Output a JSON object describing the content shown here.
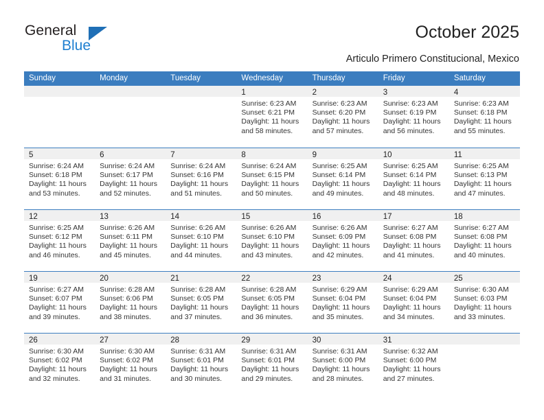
{
  "brand": {
    "name_top": "General",
    "name_bottom": "Blue",
    "accent_color": "#1f7fd0",
    "triangle_color": "#1f6fb6"
  },
  "header": {
    "title": "October 2025",
    "subtitle": "Articulo Primero Constitucional, Mexico"
  },
  "calendar": {
    "header_bg": "#3b7dbf",
    "day_strip_bg": "#f0f0f0",
    "weekdays": [
      "Sunday",
      "Monday",
      "Tuesday",
      "Wednesday",
      "Thursday",
      "Friday",
      "Saturday"
    ],
    "weeks": [
      [
        {
          "day": "",
          "lines": []
        },
        {
          "day": "",
          "lines": []
        },
        {
          "day": "",
          "lines": []
        },
        {
          "day": "1",
          "lines": [
            "Sunrise: 6:23 AM",
            "Sunset: 6:21 PM",
            "Daylight: 11 hours",
            "and 58 minutes."
          ]
        },
        {
          "day": "2",
          "lines": [
            "Sunrise: 6:23 AM",
            "Sunset: 6:20 PM",
            "Daylight: 11 hours",
            "and 57 minutes."
          ]
        },
        {
          "day": "3",
          "lines": [
            "Sunrise: 6:23 AM",
            "Sunset: 6:19 PM",
            "Daylight: 11 hours",
            "and 56 minutes."
          ]
        },
        {
          "day": "4",
          "lines": [
            "Sunrise: 6:23 AM",
            "Sunset: 6:18 PM",
            "Daylight: 11 hours",
            "and 55 minutes."
          ]
        }
      ],
      [
        {
          "day": "5",
          "lines": [
            "Sunrise: 6:24 AM",
            "Sunset: 6:18 PM",
            "Daylight: 11 hours",
            "and 53 minutes."
          ]
        },
        {
          "day": "6",
          "lines": [
            "Sunrise: 6:24 AM",
            "Sunset: 6:17 PM",
            "Daylight: 11 hours",
            "and 52 minutes."
          ]
        },
        {
          "day": "7",
          "lines": [
            "Sunrise: 6:24 AM",
            "Sunset: 6:16 PM",
            "Daylight: 11 hours",
            "and 51 minutes."
          ]
        },
        {
          "day": "8",
          "lines": [
            "Sunrise: 6:24 AM",
            "Sunset: 6:15 PM",
            "Daylight: 11 hours",
            "and 50 minutes."
          ]
        },
        {
          "day": "9",
          "lines": [
            "Sunrise: 6:25 AM",
            "Sunset: 6:14 PM",
            "Daylight: 11 hours",
            "and 49 minutes."
          ]
        },
        {
          "day": "10",
          "lines": [
            "Sunrise: 6:25 AM",
            "Sunset: 6:14 PM",
            "Daylight: 11 hours",
            "and 48 minutes."
          ]
        },
        {
          "day": "11",
          "lines": [
            "Sunrise: 6:25 AM",
            "Sunset: 6:13 PM",
            "Daylight: 11 hours",
            "and 47 minutes."
          ]
        }
      ],
      [
        {
          "day": "12",
          "lines": [
            "Sunrise: 6:25 AM",
            "Sunset: 6:12 PM",
            "Daylight: 11 hours",
            "and 46 minutes."
          ]
        },
        {
          "day": "13",
          "lines": [
            "Sunrise: 6:26 AM",
            "Sunset: 6:11 PM",
            "Daylight: 11 hours",
            "and 45 minutes."
          ]
        },
        {
          "day": "14",
          "lines": [
            "Sunrise: 6:26 AM",
            "Sunset: 6:10 PM",
            "Daylight: 11 hours",
            "and 44 minutes."
          ]
        },
        {
          "day": "15",
          "lines": [
            "Sunrise: 6:26 AM",
            "Sunset: 6:10 PM",
            "Daylight: 11 hours",
            "and 43 minutes."
          ]
        },
        {
          "day": "16",
          "lines": [
            "Sunrise: 6:26 AM",
            "Sunset: 6:09 PM",
            "Daylight: 11 hours",
            "and 42 minutes."
          ]
        },
        {
          "day": "17",
          "lines": [
            "Sunrise: 6:27 AM",
            "Sunset: 6:08 PM",
            "Daylight: 11 hours",
            "and 41 minutes."
          ]
        },
        {
          "day": "18",
          "lines": [
            "Sunrise: 6:27 AM",
            "Sunset: 6:08 PM",
            "Daylight: 11 hours",
            "and 40 minutes."
          ]
        }
      ],
      [
        {
          "day": "19",
          "lines": [
            "Sunrise: 6:27 AM",
            "Sunset: 6:07 PM",
            "Daylight: 11 hours",
            "and 39 minutes."
          ]
        },
        {
          "day": "20",
          "lines": [
            "Sunrise: 6:28 AM",
            "Sunset: 6:06 PM",
            "Daylight: 11 hours",
            "and 38 minutes."
          ]
        },
        {
          "day": "21",
          "lines": [
            "Sunrise: 6:28 AM",
            "Sunset: 6:05 PM",
            "Daylight: 11 hours",
            "and 37 minutes."
          ]
        },
        {
          "day": "22",
          "lines": [
            "Sunrise: 6:28 AM",
            "Sunset: 6:05 PM",
            "Daylight: 11 hours",
            "and 36 minutes."
          ]
        },
        {
          "day": "23",
          "lines": [
            "Sunrise: 6:29 AM",
            "Sunset: 6:04 PM",
            "Daylight: 11 hours",
            "and 35 minutes."
          ]
        },
        {
          "day": "24",
          "lines": [
            "Sunrise: 6:29 AM",
            "Sunset: 6:04 PM",
            "Daylight: 11 hours",
            "and 34 minutes."
          ]
        },
        {
          "day": "25",
          "lines": [
            "Sunrise: 6:30 AM",
            "Sunset: 6:03 PM",
            "Daylight: 11 hours",
            "and 33 minutes."
          ]
        }
      ],
      [
        {
          "day": "26",
          "lines": [
            "Sunrise: 6:30 AM",
            "Sunset: 6:02 PM",
            "Daylight: 11 hours",
            "and 32 minutes."
          ]
        },
        {
          "day": "27",
          "lines": [
            "Sunrise: 6:30 AM",
            "Sunset: 6:02 PM",
            "Daylight: 11 hours",
            "and 31 minutes."
          ]
        },
        {
          "day": "28",
          "lines": [
            "Sunrise: 6:31 AM",
            "Sunset: 6:01 PM",
            "Daylight: 11 hours",
            "and 30 minutes."
          ]
        },
        {
          "day": "29",
          "lines": [
            "Sunrise: 6:31 AM",
            "Sunset: 6:01 PM",
            "Daylight: 11 hours",
            "and 29 minutes."
          ]
        },
        {
          "day": "30",
          "lines": [
            "Sunrise: 6:31 AM",
            "Sunset: 6:00 PM",
            "Daylight: 11 hours",
            "and 28 minutes."
          ]
        },
        {
          "day": "31",
          "lines": [
            "Sunrise: 6:32 AM",
            "Sunset: 6:00 PM",
            "Daylight: 11 hours",
            "and 27 minutes."
          ]
        },
        {
          "day": "",
          "lines": []
        }
      ]
    ]
  }
}
